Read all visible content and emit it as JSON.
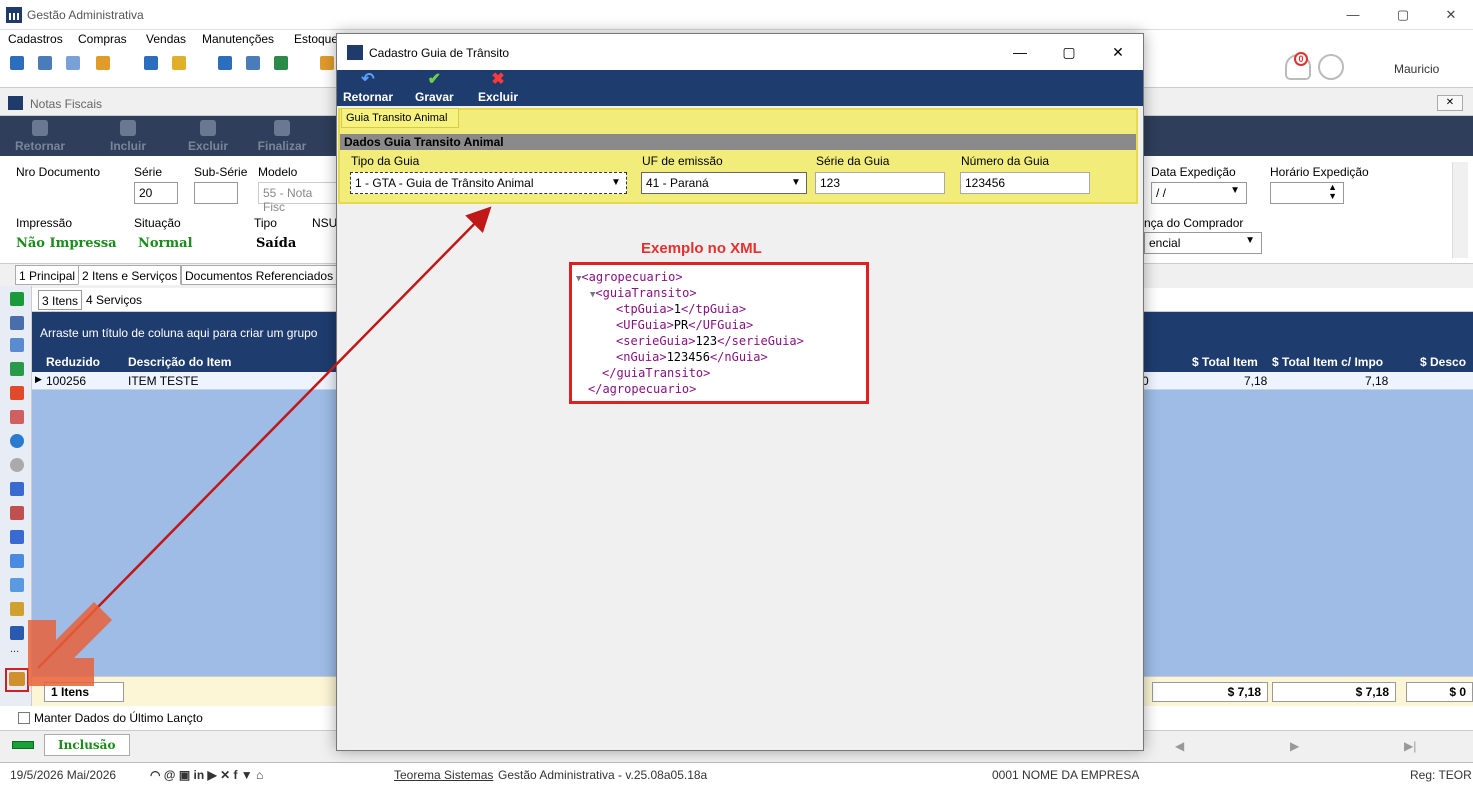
{
  "app": {
    "title": "Gestão Administrativa",
    "window_controls": {
      "minimize": "—",
      "restore": "▢",
      "close": "✕"
    },
    "menu": [
      "Cadastros",
      "Compras",
      "Vendas",
      "Manutenções",
      "Estoque"
    ],
    "user_name": "Mauricio",
    "notification_count": "0"
  },
  "notas": {
    "title": "Notas Fiscais",
    "toolbar": [
      "Retornar",
      "Incluir",
      "Excluir",
      "Finalizar"
    ],
    "fields": {
      "nro_documento": "Nro Documento",
      "serie_label": "Série",
      "serie_value": "20",
      "sub_serie_label": "Sub-Série",
      "modelo_label": "Modelo",
      "modelo_value": "55 - Nota Fisc",
      "data_expedicao_label": "Data Expedição",
      "data_expedicao_value": "/ /",
      "horario_expedicao_label": "Horário Expedição",
      "impressao_label": "Impressão",
      "impressao_value": "Não Impressa",
      "situacao_label": "Situação",
      "situacao_value": "Normal",
      "tipo_label": "Tipo",
      "tipo_value": "Saída",
      "nsu_label": "NSU",
      "comprador_label": "nça do Comprador",
      "comprador_value": "encial"
    },
    "tabs": [
      "1 Principal",
      "2 Itens e Serviços",
      "Documentos Referenciados"
    ],
    "subtabs": [
      "3 Itens",
      "4 Serviços"
    ],
    "group_hint": "Arraste um título de coluna aqui para criar um grupo",
    "columns": [
      "Reduzido",
      "Descrição do Item",
      "$ Total Item",
      "$ Total Item c/ Impo",
      "$ Desco"
    ],
    "row": {
      "reduzido": "100256",
      "descricao": "ITEM TESTE",
      "col_cut": "0",
      "total": "7,18",
      "total_imp": "7,18"
    },
    "footer": {
      "count": "1 Itens",
      "total": "$ 7,18",
      "total_imp": "$ 7,18",
      "desc": "$ 0"
    },
    "manter": "Manter Dados do Último Lançto",
    "status": "Inclusão"
  },
  "dialog": {
    "title": "Cadastro Guia de Trânsito",
    "toolbar": {
      "retornar": "Retornar",
      "gravar": "Gravar",
      "excluir": "Excluir"
    },
    "tab": "Guia Transito Animal",
    "section": "Dados Guia Transito Animal",
    "tipo_label": "Tipo da Guia",
    "tipo_value": "1 - GTA - Guia de Trânsito Animal",
    "uf_label": "UF de emissão",
    "uf_value": "41 - Paraná",
    "serie_label": "Série da Guia",
    "serie_value": "123",
    "numero_label": "Número da Guia",
    "numero_value": "123456",
    "example_title": "Exemplo no XML",
    "xml": {
      "l1": "<agropecuario>",
      "l2": "<guiaTransito>",
      "l3_open": "<tpGuia>",
      "l3_val": "1",
      "l3_close": "</tpGuia>",
      "l4_open": "<UFGuia>",
      "l4_val": "PR",
      "l4_close": "</UFGuia>",
      "l5_open": "<serieGuia>",
      "l5_val": "123",
      "l5_close": "</serieGuia>",
      "l6_open": "<nGuia>",
      "l6_val": "123456",
      "l6_close": "</nGuia>",
      "l7": "</guiaTransito>",
      "l8": "</agropecuario>"
    }
  },
  "taskbar": {
    "date": "19/5/2026 Mai/2026",
    "company_link": "Teorema Sistemas",
    "version": "Gestão Administrativa - v.25.08a05.18a",
    "empresa": "0001 NOME DA EMPRESA",
    "reg": "Reg: TEOR"
  },
  "colors": {
    "accent": "#1e3c6e",
    "highlight": "#f2ed7b",
    "annotation": "#e02020"
  }
}
